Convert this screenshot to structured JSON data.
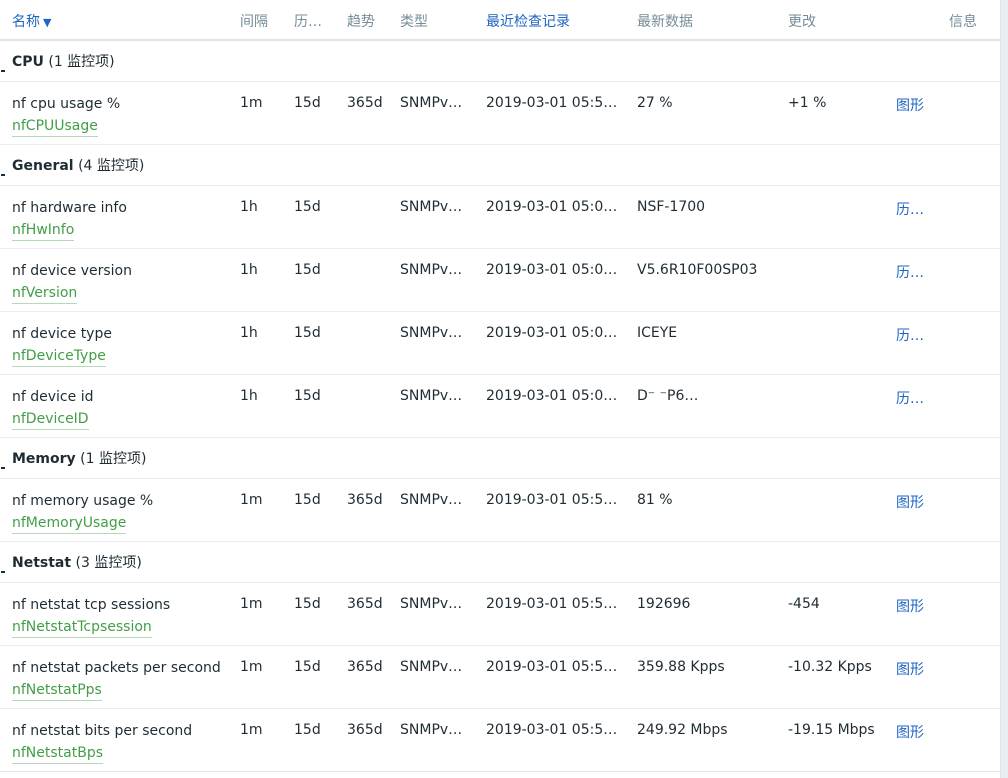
{
  "headers": {
    "name": "名称",
    "interval": "间隔",
    "history": "历…",
    "trends": "趋势",
    "type": "类型",
    "last_check": "最近检查记录",
    "last_value": "最新数据",
    "change": "更改",
    "info": "信息"
  },
  "groups": [
    {
      "name": "CPU",
      "count": "(1 监控项)",
      "items": [
        {
          "name": "nf cpu usage %",
          "key": "nfCPUUsage",
          "interval": "1m",
          "history": "15d",
          "trends": "365d",
          "type": "SNMPv…",
          "last_check": "2019-03-01 05:5…",
          "last_value": "27 %",
          "change": "+1 %",
          "action": "图形"
        }
      ]
    },
    {
      "name": "General",
      "count": "(4 监控项)",
      "items": [
        {
          "name": "nf hardware info",
          "key": "nfHwInfo",
          "interval": "1h",
          "history": "15d",
          "trends": "",
          "type": "SNMPv…",
          "last_check": "2019-03-01 05:0…",
          "last_value": "NSF-1700",
          "change": "",
          "action": "历…"
        },
        {
          "name": "nf device version",
          "key": "nfVersion",
          "interval": "1h",
          "history": "15d",
          "trends": "",
          "type": "SNMPv…",
          "last_check": "2019-03-01 05:0…",
          "last_value": "V5.6R10F00SP03",
          "change": "",
          "action": "历…"
        },
        {
          "name": "nf device type",
          "key": "nfDeviceType",
          "interval": "1h",
          "history": "15d",
          "trends": "",
          "type": "SNMPv…",
          "last_check": "2019-03-01 05:0…",
          "last_value": "ICEYE",
          "change": "",
          "action": "历…"
        },
        {
          "name": "nf device id",
          "key": "nfDeviceID",
          "interval": "1h",
          "history": "15d",
          "trends": "",
          "type": "SNMPv…",
          "last_check": "2019-03-01 05:0…",
          "last_value": "D⁻                    ⁻P6…",
          "change": "",
          "action": "历…"
        }
      ]
    },
    {
      "name": "Memory",
      "count": "(1 监控项)",
      "items": [
        {
          "name": "nf memory usage %",
          "key": "nfMemoryUsage",
          "interval": "1m",
          "history": "15d",
          "trends": "365d",
          "type": "SNMPv…",
          "last_check": "2019-03-01 05:5…",
          "last_value": "81 %",
          "change": "",
          "action": "图形"
        }
      ]
    },
    {
      "name": "Netstat",
      "count": "(3 监控项)",
      "items": [
        {
          "name": "nf netstat tcp sessions",
          "key": "nfNetstatTcpsession",
          "interval": "1m",
          "history": "15d",
          "trends": "365d",
          "type": "SNMPv…",
          "last_check": "2019-03-01 05:5…",
          "last_value": "192696",
          "change": "-454",
          "action": "图形"
        },
        {
          "name": "nf netstat packets per second",
          "key": "nfNetstatPps",
          "interval": "1m",
          "history": "15d",
          "trends": "365d",
          "type": "SNMPv…",
          "last_check": "2019-03-01 05:5…",
          "last_value": "359.88 Kpps",
          "change": "-10.32 Kpps",
          "action": "图形"
        },
        {
          "name": "nf netstat bits per second",
          "key": "nfNetstatBps",
          "interval": "1m",
          "history": "15d",
          "trends": "365d",
          "type": "SNMPv…",
          "last_check": "2019-03-01 05:5…",
          "last_value": "249.92 Mbps",
          "change": "-19.15 Mbps",
          "action": "图形"
        }
      ]
    }
  ]
}
